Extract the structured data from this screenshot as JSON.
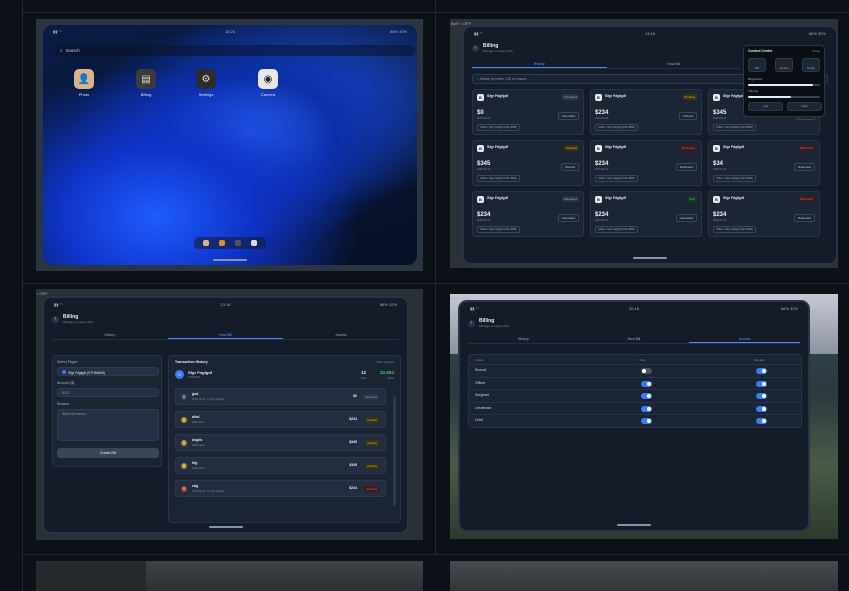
{
  "desktop": {
    "statusbar": {
      "time": "16:26",
      "battery": "88% 32%"
    },
    "search_placeholder": "Search",
    "apps": [
      {
        "label": "Photo",
        "icon": "person-icon",
        "color": "#d9b48a"
      },
      {
        "label": "Billing",
        "icon": "wallet-icon",
        "color": "#3b3b3b"
      },
      {
        "label": "Settings",
        "icon": "gear-icon",
        "color": "#2c2c2c"
      },
      {
        "label": "Camera",
        "icon": "camera-icon",
        "color": "#e8e8e8"
      }
    ]
  },
  "billing_list": {
    "off_label": "Bp/F • OFF",
    "statusbar": {
      "time": "13:16",
      "battery": "86% 32%"
    },
    "title": "Billing",
    "subtitle": "Manage company bills",
    "tabs": [
      "History",
      "New Bill"
    ],
    "search_placeholder": "Search by name, CID or reason...",
    "cards": [
      {
        "name": "Sfgr Fdgfgdf",
        "status": "Cancelled",
        "amount": "$0",
        "date": "2025-09-14",
        "button": "Cancelled",
        "footer": "Officer: Sfgr Fdgfgdf (CID-3586)"
      },
      {
        "name": "Sfgr Fdgfgdf",
        "status": "Pending",
        "amount": "$234",
        "date": "2025-09-14",
        "button": "Refund",
        "footer": "Officer: Sfgr Fdgfgdf (CID-3586)"
      },
      {
        "name": "Sfgr Fdgfgdf",
        "status": "Pending",
        "amount": "$345",
        "date": "2025-09-14",
        "button": "Refund",
        "footer": "Officer: Sfgr Fdgfgdf (CID-3586)"
      },
      {
        "name": "Sfgr Fdgfgdf",
        "status": "Pending",
        "amount": "$345",
        "date": "2025-09-14",
        "button": "Refund",
        "footer": "Officer: Sfgr Fdgfgdf (CID-3586)"
      },
      {
        "name": "Sfgr Fdgfgdf",
        "status": "Refunded",
        "amount": "$234",
        "date": "2025-09-14",
        "button": "Refunded",
        "footer": "Officer: Sfgr Fdgfgdf (CID-3586)"
      },
      {
        "name": "Sfgr Fdgfgdf",
        "status": "Refunded",
        "amount": "$34",
        "date": "2025-09-14",
        "button": "Refunded",
        "footer": "Officer: Sfgr Fdgfgdf (CID-3586)"
      },
      {
        "name": "Sfgr Fdgfgdf",
        "status": "Cancelled",
        "amount": "$234",
        "date": "2025-09-14",
        "button": "Cancelled",
        "footer": "Officer: Sfgr Fdgfgdf (CID-3586)"
      },
      {
        "name": "Sfgr Fdgfgdf",
        "status": "Paid",
        "amount": "$234",
        "date": "2025-09-14",
        "button": "Cancelled",
        "footer": "Officer: Sfgr Fdgfgdf (CID-3586)"
      },
      {
        "name": "Sfgr Fdgfgdf",
        "status": "Refunded",
        "amount": "$234",
        "date": "2025-09-14",
        "button": "Refunded",
        "footer": "Officer: Sfgr Fdgfgdf (CID-3586)"
      }
    ],
    "control_center": {
      "title": "Control Center",
      "close": "Close",
      "buttons": [
        "Wifi",
        "Airplane",
        "Airdrop"
      ],
      "brightness_label": "Brightness",
      "brightness": 0.9,
      "volume_label": "Volume",
      "volume": 0.6,
      "lock_label": "Lock",
      "flash_label": "Flash"
    }
  },
  "new_bill": {
    "off_label": "• OFF",
    "statusbar": {
      "time": "13:16",
      "battery": "86% 32%"
    },
    "title": "Billing",
    "subtitle": "Manage company bills",
    "tabs": [
      "History",
      "New Bill",
      "Access"
    ],
    "form": {
      "select_label": "Select Player",
      "selected_player": "Sfgr Fdgfgdf (STH54695)",
      "amount_label": "Amount ($)",
      "amount_placeholder": "$123",
      "reason_label": "Reason",
      "reason_placeholder": "Write bill reason...",
      "submit": "Create Bill"
    },
    "history": {
      "title": "Transaction History",
      "action": "Filter product",
      "player": "Sfgr Fdgfgdf",
      "player_sub": "STH54695",
      "bills_total": "12",
      "bills_label": "Total",
      "value_total": "$2,684",
      "value_label": "Value",
      "rows": [
        {
          "name": "gsd",
          "date": "2025-09-14 • by Sfgr Fdgfgdf",
          "amount": "$0",
          "status": "cancelled",
          "color": "#9aa6b8"
        },
        {
          "name": "dfsd",
          "date": "2025-09-14",
          "amount": "$234",
          "status": "pending",
          "color": "#e0b341"
        },
        {
          "name": "dsgds",
          "date": "2025-09-14",
          "amount": "$345",
          "status": "pending",
          "color": "#e0b341"
        },
        {
          "name": "hfg",
          "date": "2025-09-14",
          "amount": "$345",
          "status": "pending",
          "color": "#e0b341"
        },
        {
          "name": "sdg",
          "date": "2025-09-14 • by Sfgr Fdgfgdf",
          "amount": "$234",
          "status": "refunded",
          "color": "#e05555"
        }
      ]
    }
  },
  "access": {
    "off_label": "Bp/F • OFF",
    "statusbar": {
      "time": "20:16",
      "battery": "86% 32%"
    },
    "title": "Billing",
    "subtitle": "Manage company bills",
    "tabs": [
      "History",
      "New Bill",
      "Access"
    ],
    "columns": [
      "Grade",
      "View",
      "Manage"
    ],
    "rows": [
      {
        "grade": "Recruit",
        "view": false,
        "manage": true
      },
      {
        "grade": "Officer",
        "view": true,
        "manage": true
      },
      {
        "grade": "Sergeant",
        "view": true,
        "manage": true
      },
      {
        "grade": "Lieutenant",
        "view": true,
        "manage": true
      },
      {
        "grade": "Chief",
        "view": true,
        "manage": true
      }
    ]
  }
}
